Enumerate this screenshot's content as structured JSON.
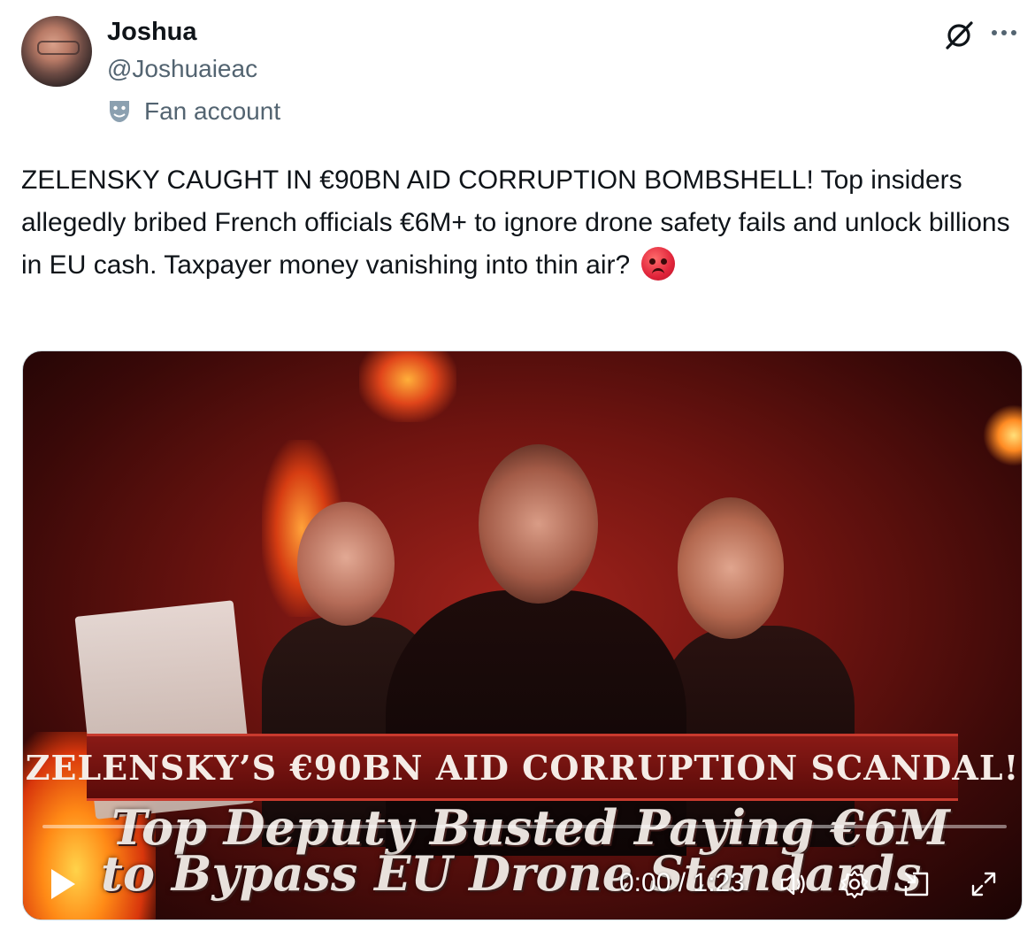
{
  "author": {
    "display_name": "Joshua",
    "handle": "@Joshuaieac",
    "label": "Fan account"
  },
  "tweet": {
    "text": "ZELENSKY CAUGHT IN €90BN AID CORRUPTION BOMBSHELL! Top insiders allegedly bribed French officials €6M+ to ignore drone safety fails and unlock billions in EU cash. Taxpayer money vanishing into thin air?"
  },
  "video": {
    "banner_text": "ZELENSKY’S €90BN AID CORRUPTION SCANDAL!",
    "headline_line1": "Top Deputy Busted Paying €6M",
    "headline_line2": "to Bypass EU Drone Standards",
    "time_display": "0:00 / 1:23",
    "progress": 0.0
  },
  "icons": {
    "grok": "grok-icon",
    "more": "more-icon",
    "label": "theater-mask-icon",
    "emoji": "angry-face-emoji",
    "play": "play-icon",
    "volume": "volume-icon",
    "settings": "gear-icon",
    "pip": "picture-in-picture-icon",
    "fullscreen": "fullscreen-icon"
  },
  "colors": {
    "text": "#0f1419",
    "secondary": "#536471",
    "accent": "#1d9bf0"
  }
}
